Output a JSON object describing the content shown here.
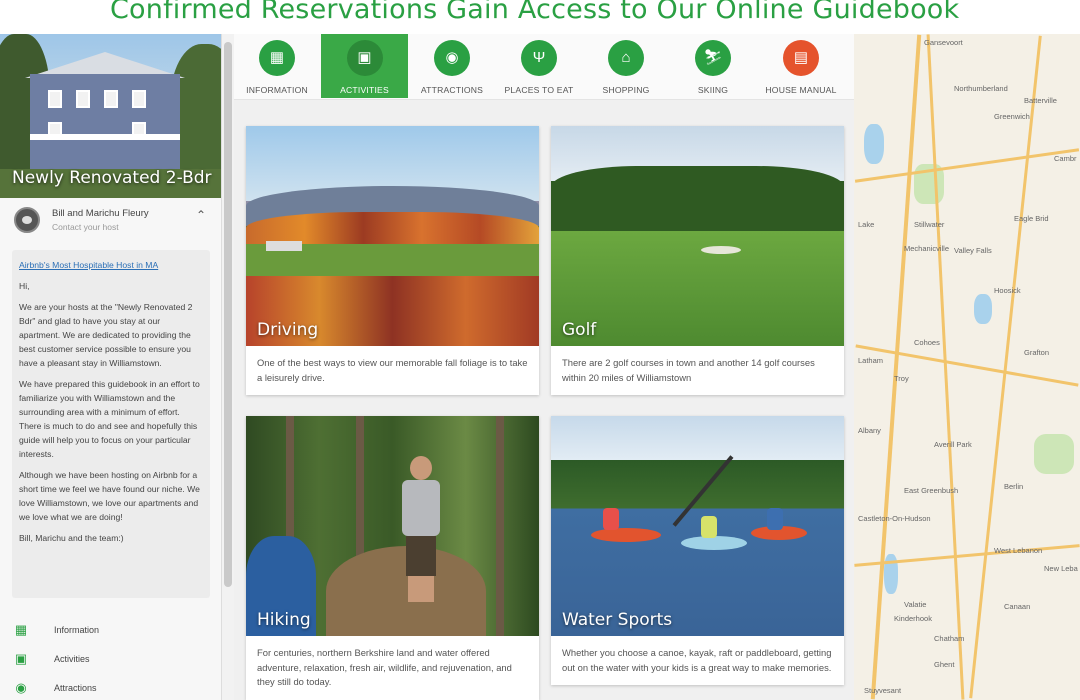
{
  "banner": {
    "title": "Confirmed Reservations Gain Access to Our Online Guidebook"
  },
  "listing": {
    "title": "Newly Renovated 2-Bdr"
  },
  "host": {
    "name": "Bill and Marichu Fleury",
    "subtitle": "Contact your host"
  },
  "message": {
    "link": "Airbnb's Most Hospitable Host in MA",
    "paragraphs": [
      "Hi,",
      "We are your hosts at the \"Newly Renovated 2 Bdr\" and glad to have you stay at our apartment. We are dedicated to providing the best customer service possible to ensure you have a pleasant stay in Williamstown.",
      "We have prepared this guidebook in an effort to familiarize you with Williamstown and the surrounding area with a minimum of effort. There is much to do and see and hopefully this guide will help you to focus on your particular interests.",
      "Although we have been hosting on Airbnb for a short time we feel we have found our niche. We love Williamstown, we love our apartments and we love what we are doing!",
      "Bill, Marichu and the team:)"
    ]
  },
  "sidebar_nav": [
    {
      "label": "Information",
      "icon": "grid-icon"
    },
    {
      "label": "Activities",
      "icon": "ticket-icon"
    },
    {
      "label": "Attractions",
      "icon": "camera-icon"
    }
  ],
  "tabs": [
    {
      "label": "INFORMATION",
      "icon": "grid-icon",
      "glyph": "▦"
    },
    {
      "label": "ACTIVITIES",
      "icon": "ticket-icon",
      "glyph": "▣"
    },
    {
      "label": "ATTRACTIONS",
      "icon": "camera-icon",
      "glyph": "◉"
    },
    {
      "label": "PLACES TO EAT",
      "icon": "utensils-icon",
      "glyph": "Ψ"
    },
    {
      "label": "SHOPPING",
      "icon": "basket-icon",
      "glyph": "⌂"
    },
    {
      "label": "SKIING",
      "icon": "skier-icon",
      "glyph": "⛷"
    },
    {
      "label": "HOUSE MANUAL",
      "icon": "book-icon",
      "glyph": "▤"
    }
  ],
  "cards": [
    {
      "title": "Driving",
      "description": "One of the best ways to view our memorable fall foliage is to take a leisurely drive."
    },
    {
      "title": "Golf",
      "description": "There are 2 golf courses in town and another 14 golf courses within 20 miles of Williamstown"
    },
    {
      "title": "Hiking",
      "description": "For centuries, northern Berkshire land and water offered adventure, relaxation, fresh air, wildlife, and rejuvenation, and they still do today."
    },
    {
      "title": "Water Sports",
      "description": "Whether you choose a canoe, kayak, raft or paddleboard, getting out on the water with your kids is a great way to make memories."
    }
  ],
  "map": {
    "towns": [
      "Gansevoort",
      "Northumberland",
      "Batterville",
      "Greenwich",
      "Cambr",
      "Lake",
      "Stillwater",
      "Eagle Brid",
      "Mechanicville",
      "Valley Falls",
      "Hoosick",
      "Latham",
      "Cohoes",
      "Troy",
      "Grafton",
      "Albany",
      "Averill Park",
      "East Greenbush",
      "Berlin",
      "Castleton-On-Hudson",
      "West Lebanon",
      "New Leba",
      "Valatie",
      "Kinderhook",
      "Canaan",
      "Chatham",
      "Ghent",
      "Stuyvesant"
    ]
  },
  "colors": {
    "accent": "#2aa043",
    "active_tab": "#3aa947",
    "house_manual": "#e5532c",
    "link": "#2b6fb6"
  }
}
